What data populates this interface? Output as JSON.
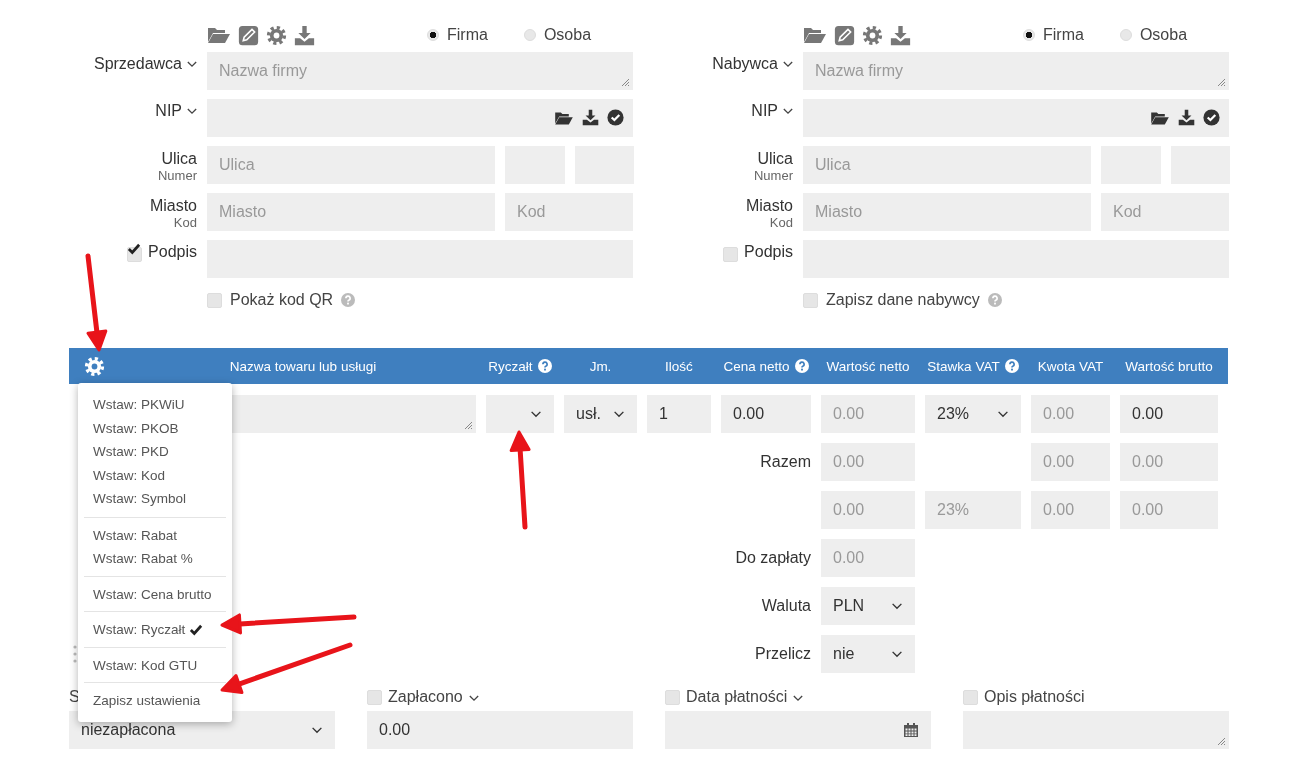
{
  "parties": [
    {
      "label": "Sprzedawca",
      "types": [
        {
          "label": "Firma",
          "selected": true
        },
        {
          "label": "Osoba",
          "selected": false
        }
      ],
      "name_placeholder": "Nazwa firmy",
      "nip_label": "NIP",
      "street_label": "Ulica",
      "number_label": "Numer",
      "street_placeholder": "Ulica",
      "city_label": "Miasto",
      "postcode_label": "Kod",
      "city_placeholder": "Miasto",
      "postcode_placeholder": "Kod",
      "signature": {
        "label": "Podpis",
        "checked": true
      },
      "extra_option": {
        "label": "Pokaż kod QR",
        "checked": false
      }
    },
    {
      "label": "Nabywca",
      "types": [
        {
          "label": "Firma",
          "selected": true
        },
        {
          "label": "Osoba",
          "selected": false
        }
      ],
      "name_placeholder": "Nazwa firmy",
      "nip_label": "NIP",
      "street_label": "Ulica",
      "number_label": "Numer",
      "street_placeholder": "Ulica",
      "city_label": "Miasto",
      "postcode_label": "Kod",
      "city_placeholder": "Miasto",
      "postcode_placeholder": "Kod",
      "signature": {
        "label": "Podpis",
        "checked": false
      },
      "extra_option": {
        "label": "Zapisz dane nabywcy",
        "checked": false
      }
    }
  ],
  "items_table": {
    "columns": [
      {
        "label": "Nazwa towaru lub usługi",
        "help": false
      },
      {
        "label": "Ryczałt",
        "help": true
      },
      {
        "label": "Jm.",
        "help": false
      },
      {
        "label": "Ilość",
        "help": false
      },
      {
        "label": "Cena netto",
        "help": true
      },
      {
        "label": "Wartość netto",
        "help": false
      },
      {
        "label": "Stawka VAT",
        "help": true
      },
      {
        "label": "Kwota VAT",
        "help": false
      },
      {
        "label": "Wartość brutto",
        "help": false
      }
    ],
    "rows": [
      {
        "unit": "usł.",
        "quantity": "1",
        "net_price": "0.00",
        "net_value": "0.00",
        "vat_rate": "23%",
        "vat_amount": "0.00",
        "gross_value": "0.00"
      }
    ]
  },
  "summary": {
    "total_label": "Razem",
    "total": {
      "net": "0.00",
      "vat": "0.00",
      "gross": "0.00"
    },
    "by_rate": [
      {
        "net": "0.00",
        "rate": "23%",
        "vat": "0.00",
        "gross": "0.00"
      }
    ],
    "to_pay_label": "Do zapłaty",
    "to_pay": "0.00",
    "currency_label": "Waluta",
    "currency": "PLN",
    "convert_label": "Przelicz",
    "convert": "nie"
  },
  "settings_menu": {
    "groups": [
      [
        {
          "kind": "option",
          "label": "Wstaw: PKWiU",
          "checked": false
        },
        {
          "kind": "option",
          "label": "Wstaw: PKOB",
          "checked": false
        },
        {
          "kind": "option",
          "label": "Wstaw: PKD",
          "checked": false
        },
        {
          "kind": "option",
          "label": "Wstaw: Kod",
          "checked": false
        },
        {
          "kind": "option",
          "label": "Wstaw: Symbol",
          "checked": false
        }
      ],
      [
        {
          "kind": "option",
          "label": "Wstaw: Rabat",
          "checked": false
        },
        {
          "kind": "option",
          "label": "Wstaw: Rabat %",
          "checked": false
        }
      ],
      [
        {
          "kind": "option",
          "label": "Wstaw: Cena brutto",
          "checked": false
        }
      ],
      [
        {
          "kind": "option",
          "label": "Wstaw: Ryczałt",
          "checked": true
        }
      ],
      [
        {
          "kind": "option",
          "label": "Wstaw: Kod GTU",
          "checked": false
        }
      ],
      [
        {
          "kind": "action",
          "label": "Zapisz ustawienia"
        }
      ]
    ]
  },
  "payment": {
    "status_label": "S",
    "status": "niezapłacona",
    "paid": {
      "label": "Zapłacono",
      "checked": false,
      "value": "0.00"
    },
    "due_date": {
      "label": "Data płatności",
      "checked": false
    },
    "description": {
      "label": "Opis płatności",
      "checked": false
    }
  },
  "annotations": [
    {
      "kind": "arrow"
    },
    {
      "kind": "arrow"
    },
    {
      "kind": "arrow"
    },
    {
      "kind": "arrow"
    }
  ]
}
